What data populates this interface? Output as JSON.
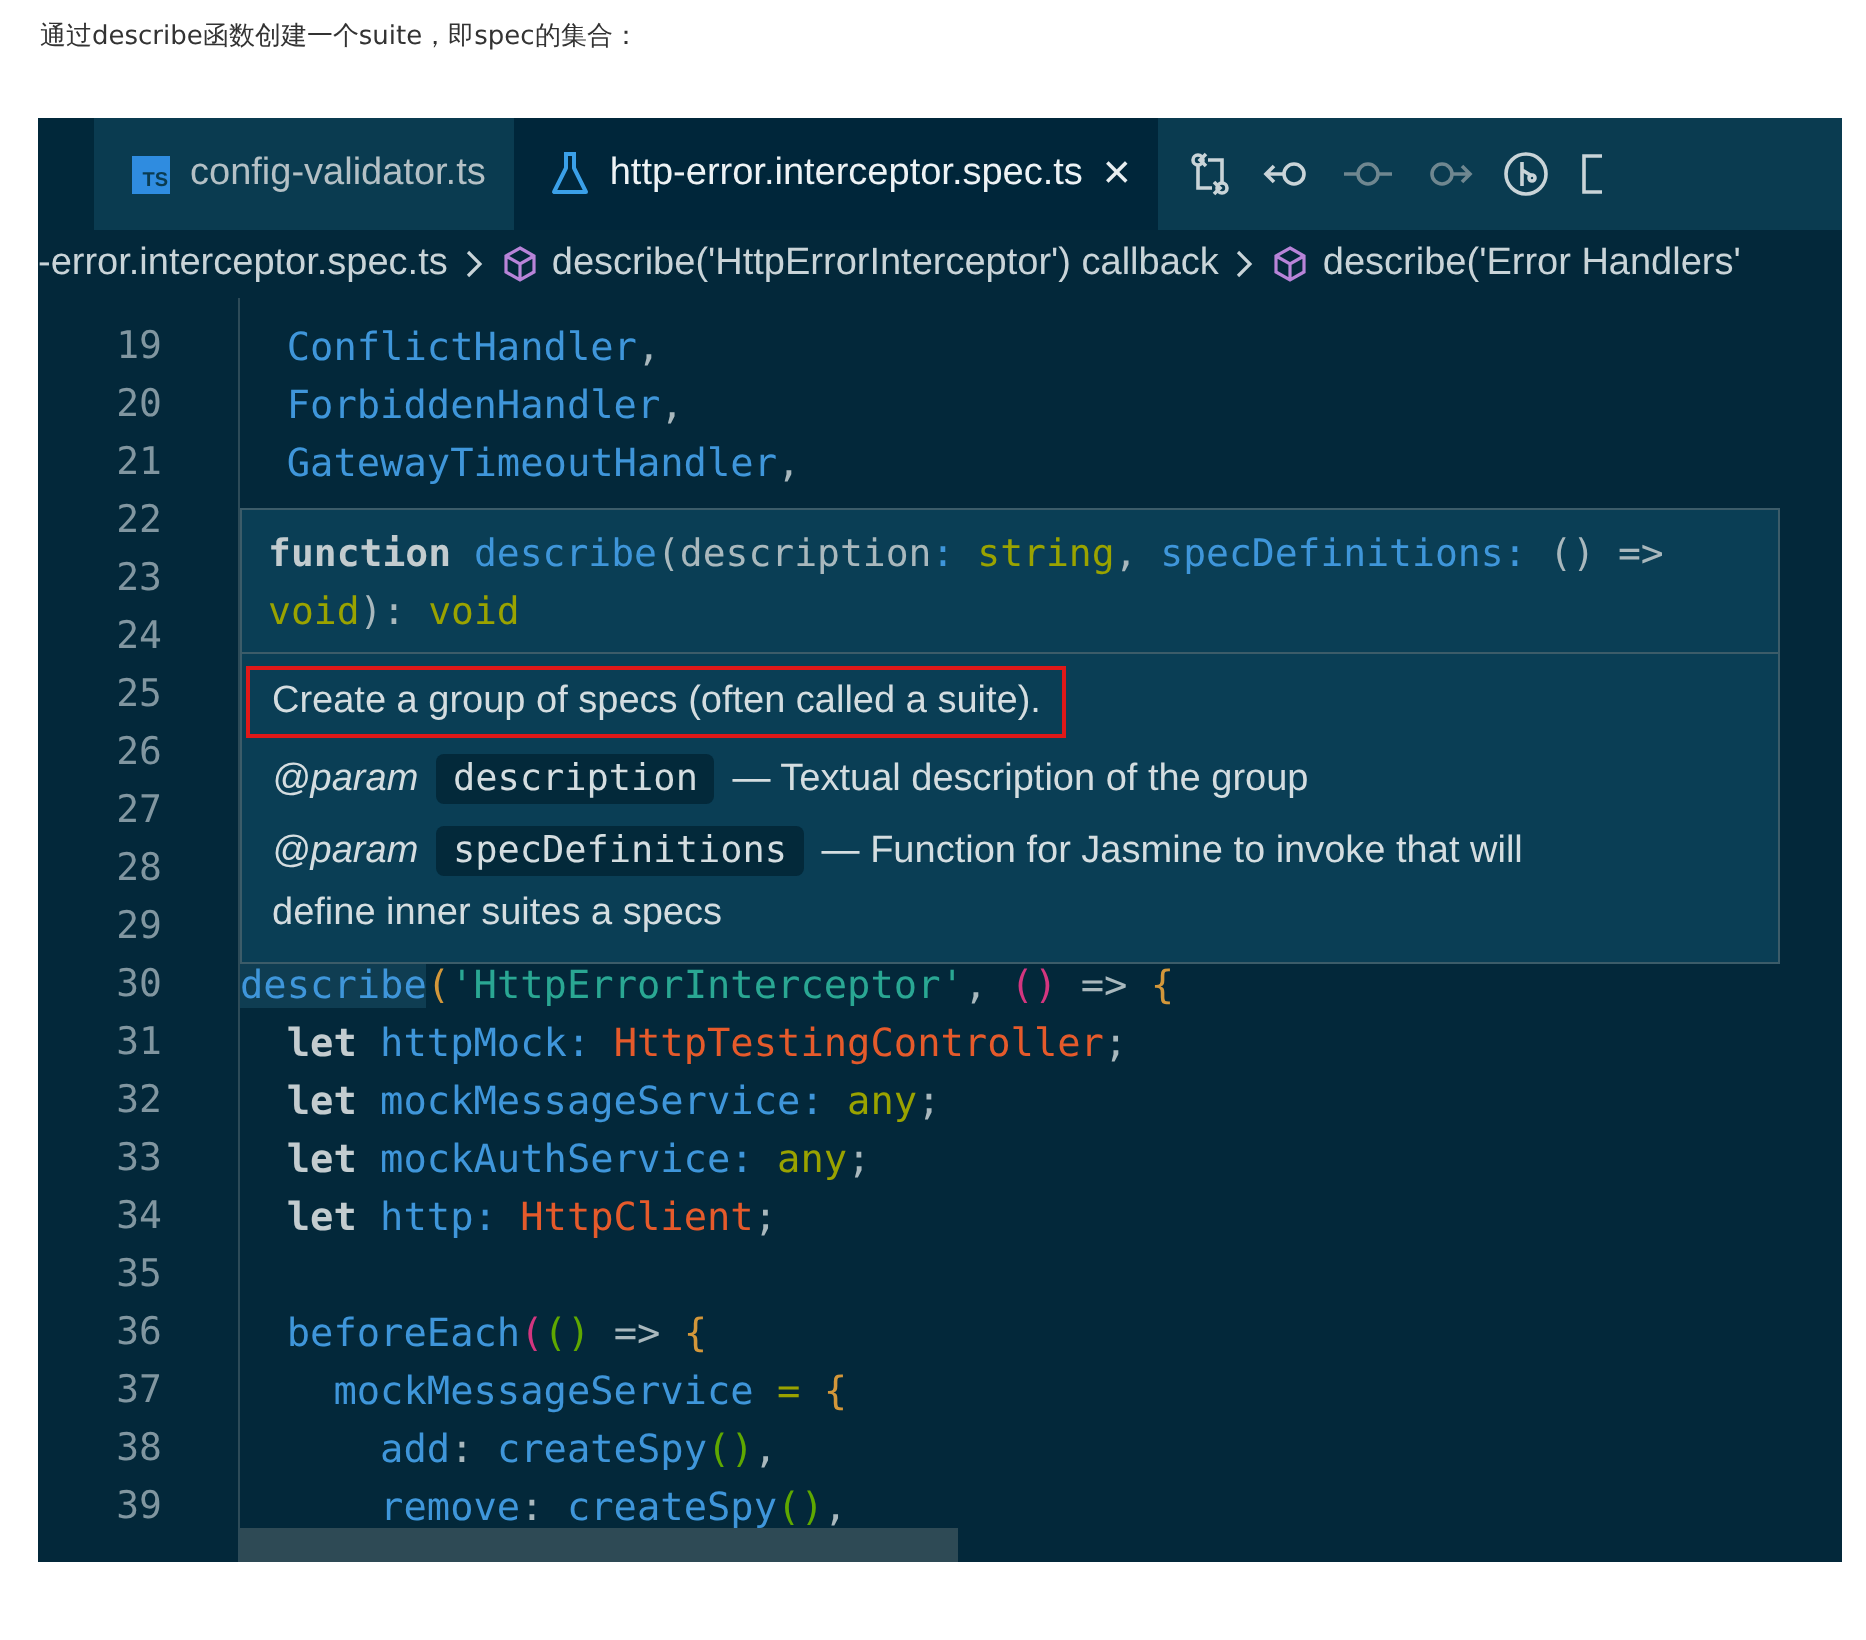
{
  "caption": "通过describe函数创建一个suite，即spec的集合：",
  "tabs": [
    {
      "kind": "ts",
      "badge": "TS",
      "label": "config-validator.ts",
      "selected": false
    },
    {
      "kind": "test",
      "label": "http-error.interceptor.spec.ts",
      "selected": true,
      "close": "×"
    }
  ],
  "breadcrumbs": [
    {
      "kind": "file",
      "label": "-error.interceptor.spec.ts"
    },
    {
      "kind": "symbol",
      "label": "describe('HttpErrorInterceptor') callback"
    },
    {
      "kind": "symbol",
      "label": "describe('Error Handlers'"
    }
  ],
  "lines": [
    {
      "number": "19",
      "tokens": [
        {
          "text": "  ConflictHandler",
          "kind": "id"
        },
        {
          "text": ",",
          "kind": "punc"
        }
      ]
    },
    {
      "number": "20",
      "tokens": [
        {
          "text": "  ForbiddenHandler",
          "kind": "id"
        },
        {
          "text": ",",
          "kind": "punc"
        }
      ]
    },
    {
      "number": "21",
      "tokens": [
        {
          "text": "  GatewayTimeoutHandler",
          "kind": "id"
        },
        {
          "text": ",",
          "kind": "punc"
        }
      ]
    },
    {
      "number": "22"
    },
    {
      "number": "23"
    },
    {
      "number": "24"
    },
    {
      "number": "25"
    },
    {
      "number": "26"
    },
    {
      "number": "27"
    },
    {
      "number": "28"
    },
    {
      "number": "29"
    },
    {
      "number": "30",
      "tokens": [
        {
          "text": "describe",
          "kind": "id",
          "highlighted": true
        },
        {
          "text": "(",
          "kind": "p1"
        },
        {
          "text": "'HttpErrorInterceptor'",
          "kind": "str"
        },
        {
          "text": ", ",
          "kind": "punc"
        },
        {
          "text": "()",
          "kind": "p2"
        },
        {
          "text": " => ",
          "kind": "punc"
        },
        {
          "text": "{",
          "kind": "p1"
        }
      ]
    },
    {
      "number": "31",
      "tokens": [
        {
          "text": "  let ",
          "kind": "kw"
        },
        {
          "text": "httpMock",
          "kind": "id"
        },
        {
          "text": ": ",
          "kind": "id"
        },
        {
          "text": "HttpTestingController",
          "kind": "type"
        },
        {
          "text": ";",
          "kind": "punc"
        }
      ]
    },
    {
      "number": "32",
      "tokens": [
        {
          "text": "  let ",
          "kind": "kw"
        },
        {
          "text": "mockMessageService",
          "kind": "id"
        },
        {
          "text": ": ",
          "kind": "id"
        },
        {
          "text": "any",
          "kind": "prim"
        },
        {
          "text": ";",
          "kind": "punc"
        }
      ]
    },
    {
      "number": "33",
      "tokens": [
        {
          "text": "  let ",
          "kind": "kw"
        },
        {
          "text": "mockAuthService",
          "kind": "id"
        },
        {
          "text": ": ",
          "kind": "id"
        },
        {
          "text": "any",
          "kind": "prim"
        },
        {
          "text": ";",
          "kind": "punc"
        }
      ]
    },
    {
      "number": "34",
      "tokens": [
        {
          "text": "  let ",
          "kind": "kw"
        },
        {
          "text": "http",
          "kind": "id"
        },
        {
          "text": ": ",
          "kind": "id"
        },
        {
          "text": "HttpClient",
          "kind": "type"
        },
        {
          "text": ";",
          "kind": "punc"
        }
      ]
    },
    {
      "number": "35"
    },
    {
      "number": "36",
      "tokens": [
        {
          "text": "  beforeEach",
          "kind": "id"
        },
        {
          "text": "(",
          "kind": "p2"
        },
        {
          "text": "()",
          "kind": "p3"
        },
        {
          "text": " => ",
          "kind": "punc"
        },
        {
          "text": "{",
          "kind": "p1"
        }
      ]
    },
    {
      "number": "37",
      "tokens": [
        {
          "text": "    mockMessageService",
          "kind": "id"
        },
        {
          "text": " = ",
          "kind": "prim"
        },
        {
          "text": "{",
          "kind": "p1"
        }
      ]
    },
    {
      "number": "38",
      "tokens": [
        {
          "text": "      add",
          "kind": "id"
        },
        {
          "text": ": ",
          "kind": "punc"
        },
        {
          "text": "createSpy",
          "kind": "id"
        },
        {
          "text": "()",
          "kind": "p3"
        },
        {
          "text": ",",
          "kind": "punc"
        }
      ]
    },
    {
      "number": "39",
      "tokens": [
        {
          "text": "      remove",
          "kind": "id"
        },
        {
          "text": ": ",
          "kind": "punc"
        },
        {
          "text": "createSpy",
          "kind": "id"
        },
        {
          "text": "()",
          "kind": "p3"
        },
        {
          "text": ",",
          "kind": "punc"
        }
      ]
    }
  ],
  "hover": {
    "signature": [
      [
        {
          "text": "function ",
          "kind": "kw"
        },
        {
          "text": "describe",
          "kind": "id"
        },
        {
          "text": "(description",
          "kind": "punc"
        },
        {
          "text": ": ",
          "kind": "id"
        },
        {
          "text": "string",
          "kind": "prim"
        },
        {
          "text": ", ",
          "kind": "punc"
        },
        {
          "text": "specDefinitions",
          "kind": "id"
        },
        {
          "text": ": ",
          "kind": "id"
        },
        {
          "text": "() =>",
          "kind": "punc"
        }
      ],
      [
        {
          "text": "void",
          "kind": "prim"
        },
        {
          "text": "): ",
          "kind": "punc"
        },
        {
          "text": "void",
          "kind": "prim"
        }
      ]
    ],
    "summary": "Create a group of specs (often called a suite).",
    "summary_marked": true,
    "params": [
      {
        "tag": "@param",
        "name": "description",
        "text": "— Textual description of the group"
      },
      {
        "tag": "@param",
        "name": "specDefinitions",
        "text": "— Function for Jasmine to invoke that will define inner suites a specs"
      }
    ]
  }
}
